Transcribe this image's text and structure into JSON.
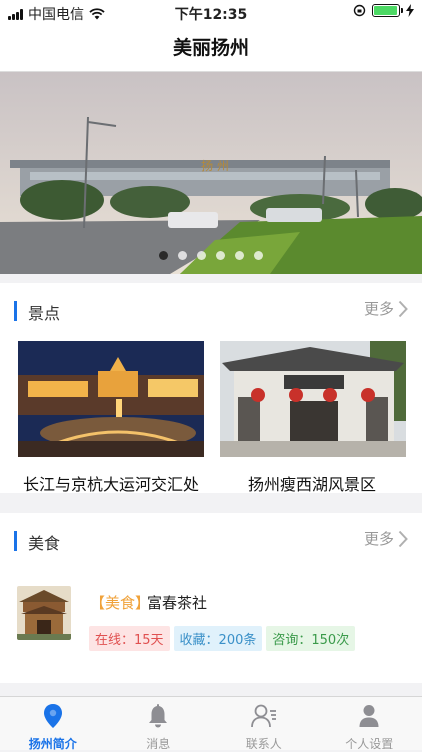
{
  "status": {
    "carrier": "中国电信",
    "time": "下午12:35",
    "battery_level": 0.95
  },
  "nav": {
    "title": "美丽扬州"
  },
  "banner": {
    "sign_text": "扬 州",
    "page_count": 6,
    "active_index": 0
  },
  "scenic": {
    "title": "景点",
    "more_label": "更多",
    "items": [
      {
        "name": "长江与京杭大运河交汇处"
      },
      {
        "name": "扬州瘦西湖风景区"
      }
    ]
  },
  "food": {
    "title": "美食",
    "more_label": "更多",
    "item": {
      "tag": "【美食】",
      "name": "富春茶社",
      "online": "在线：15天",
      "favorites": "收藏：200条",
      "consult": "咨询：150次"
    }
  },
  "tabs": [
    {
      "label": "扬州简介",
      "icon": "location-pin-icon",
      "active": true
    },
    {
      "label": "消息",
      "icon": "bell-icon",
      "active": false
    },
    {
      "label": "联系人",
      "icon": "contacts-icon",
      "active": false
    },
    {
      "label": "个人设置",
      "icon": "user-icon",
      "active": false
    }
  ],
  "colors": {
    "accent": "#1a73e8",
    "food_tag": "#f0a23a",
    "badge_online": "#e05050",
    "badge_favorites": "#3a90c8",
    "badge_consult": "#3a9a4a"
  }
}
